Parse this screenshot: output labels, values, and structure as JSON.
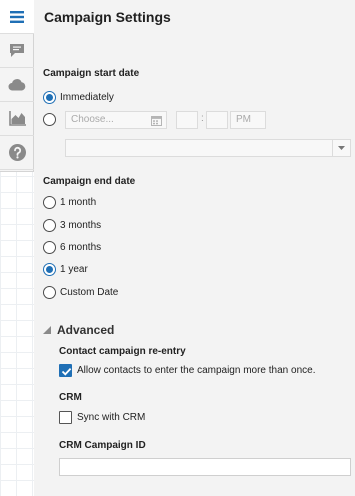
{
  "toolbar": {
    "items": [
      {
        "icon": "hamburger-menu-icon",
        "active": true
      },
      {
        "icon": "comment-icon",
        "active": false
      },
      {
        "icon": "cloud-icon",
        "active": false
      },
      {
        "icon": "area-chart-icon",
        "active": false
      },
      {
        "icon": "help-icon",
        "active": false
      }
    ],
    "accent": "#1f6fb5"
  },
  "panel": {
    "title": "Campaign Settings"
  },
  "start_date": {
    "label": "Campaign start date",
    "options": [
      {
        "label": "Immediately",
        "checked": true
      },
      {
        "label": "",
        "checked": false
      }
    ],
    "date_placeholder": "Choose...",
    "hour": "",
    "minute": "",
    "ampm": "PM",
    "timezone": ""
  },
  "end_date": {
    "label": "Campaign end date",
    "options": [
      {
        "label": "1 month",
        "checked": false
      },
      {
        "label": "3 months",
        "checked": false
      },
      {
        "label": "6 months",
        "checked": false
      },
      {
        "label": "1 year",
        "checked": true
      },
      {
        "label": "Custom Date",
        "checked": false
      }
    ]
  },
  "advanced": {
    "title": "Advanced",
    "reentry_label": "Contact campaign re-entry",
    "reentry_checkbox": {
      "label": "Allow contacts to enter the campaign more than once.",
      "checked": true
    },
    "crm_label": "CRM",
    "crm_checkbox": {
      "label": "Sync with CRM",
      "checked": false
    },
    "crm_id_label": "CRM Campaign ID",
    "crm_id_value": ""
  }
}
